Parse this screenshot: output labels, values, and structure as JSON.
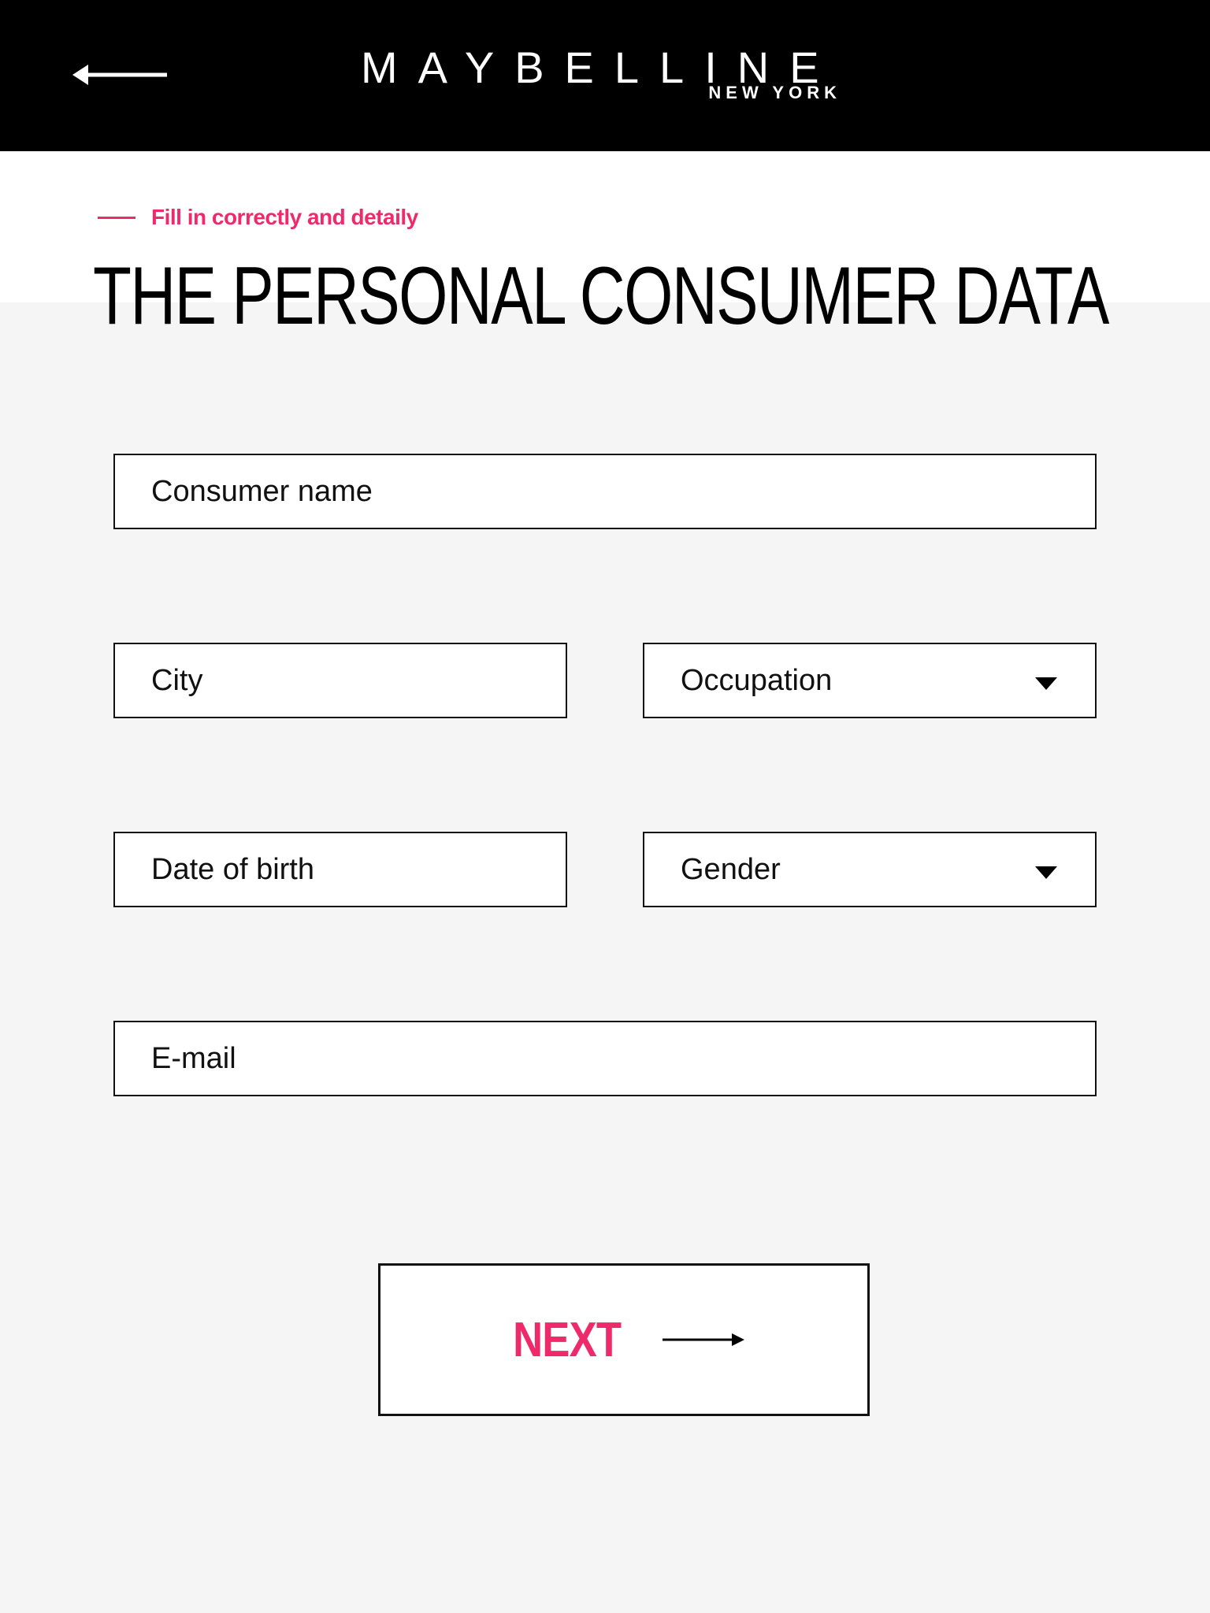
{
  "header": {
    "brand": "MAYBELLINE",
    "brand_sub": "NEW YORK",
    "back_icon": "arrow-left-icon",
    "background": "#000000"
  },
  "intro": {
    "subtitle": "Fill in correctly and detaily",
    "title": "THE PERSONAL CONSUMER DATA",
    "accent_color": "#ee2a6b"
  },
  "form": {
    "consumer_name": {
      "placeholder": "Consumer name",
      "value": ""
    },
    "city": {
      "placeholder": "City",
      "value": ""
    },
    "occupation": {
      "placeholder": "Occupation",
      "icon": "caret-down-icon"
    },
    "date_of_birth": {
      "placeholder": "Date of birth",
      "value": ""
    },
    "gender": {
      "placeholder": "Gender",
      "icon": "caret-down-icon"
    },
    "email": {
      "placeholder": "E-mail",
      "value": ""
    }
  },
  "actions": {
    "next_label": "NEXT",
    "next_icon": "arrow-right-icon"
  }
}
